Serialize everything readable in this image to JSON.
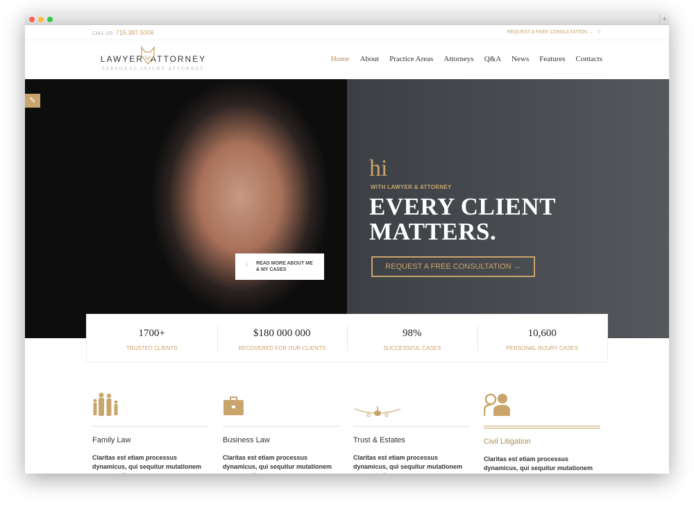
{
  "topbar": {
    "call_label": "CALL US:",
    "phone": "715.387.5006",
    "request": "REQUEST A FREE CONSULTATION →"
  },
  "logo": {
    "title": "LAWYER  ATTORNEY",
    "subtitle": "PERSONAL INJURY ATTORNRY"
  },
  "nav": {
    "items": [
      "Home",
      "About",
      "Practice Areas",
      "Attorneys",
      "Q&A",
      "News",
      "Features",
      "Contacts"
    ],
    "active": "Home"
  },
  "hero": {
    "hi": "hi",
    "with": "WITH LAWYER & ATTORNEY",
    "headline1": "EVERY CLIENT",
    "headline2": "MATTERS.",
    "cta": "REQUEST A FREE CONSULTATION →",
    "readmore1": "READ MORE ABOUT ME",
    "readmore2": "& MY CASES"
  },
  "stats": [
    {
      "n": "1700+",
      "l": "TRUSTED CLIENTS"
    },
    {
      "n": "$180 000 000",
      "l": "RECOVERED FOR OUR CLIENTS"
    },
    {
      "n": "98%",
      "l": "SUCCESSFUL CASES"
    },
    {
      "n": "10,600",
      "l": "PERSONAL INJURY CASES"
    }
  ],
  "features": [
    {
      "icon": "family-icon",
      "title": "Family Law",
      "desc": "Claritas est etiam processus dynamicus, qui sequitur mutationem consuetudium"
    },
    {
      "icon": "briefcase-icon",
      "title": "Business Law",
      "desc": "Claritas est etiam processus dynamicus, qui sequitur mutationem consuetudium"
    },
    {
      "icon": "airplane-icon",
      "title": "Trust & Estates",
      "desc": "Claritas est etiam processus dynamicus, qui sequitur mutationem consuetudium"
    },
    {
      "icon": "people-icon",
      "title": "Civil Litigation",
      "desc": "Claritas est etiam processus dynamicus, qui sequitur mutationem consuetudium"
    }
  ],
  "colors": {
    "accent": "#c9a56b",
    "hero_right": "#43464b"
  }
}
